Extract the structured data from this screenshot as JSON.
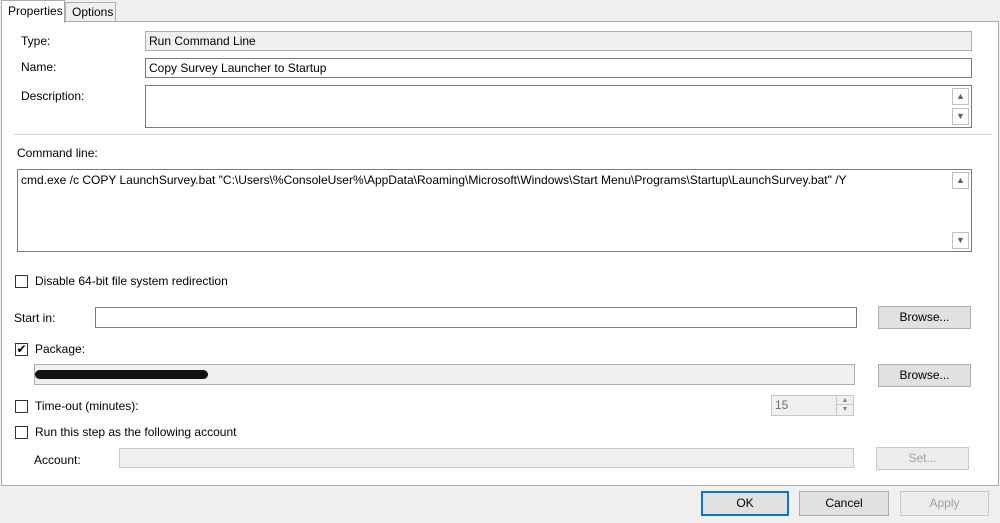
{
  "tabs": [
    {
      "label": "Properties"
    },
    {
      "label": "Options"
    }
  ],
  "form": {
    "type_label": "Type:",
    "type_value": "Run Command Line",
    "name_label": "Name:",
    "name_value": "Copy Survey Launcher to Startup",
    "description_label": "Description:",
    "description_value": "",
    "command_line_label": "Command line:",
    "command_line_value": "cmd.exe /c COPY LaunchSurvey.bat \"C:\\Users\\%ConsoleUser%\\AppData\\Roaming\\Microsoft\\Windows\\Start Menu\\Programs\\Startup\\LaunchSurvey.bat\" /Y",
    "disable_redirection_label": "Disable 64-bit file system redirection",
    "disable_redirection_checked": false,
    "start_in_label": "Start in:",
    "start_in_value": "",
    "browse_label": "Browse...",
    "package_label": "Package:",
    "package_checked": true,
    "package_value_redacted": true,
    "package_browse_label": "Browse...",
    "timeout_label": "Time-out (minutes):",
    "timeout_checked": false,
    "timeout_value": "15",
    "run_as_label": "Run this step as the following account",
    "run_as_checked": false,
    "account_label": "Account:",
    "account_value": "",
    "set_label": "Set..."
  },
  "footer": {
    "ok_label": "OK",
    "cancel_label": "Cancel",
    "apply_label": "Apply"
  },
  "icons": {
    "check": "✔",
    "scroll_up": "▲",
    "scroll_down": "▼"
  }
}
